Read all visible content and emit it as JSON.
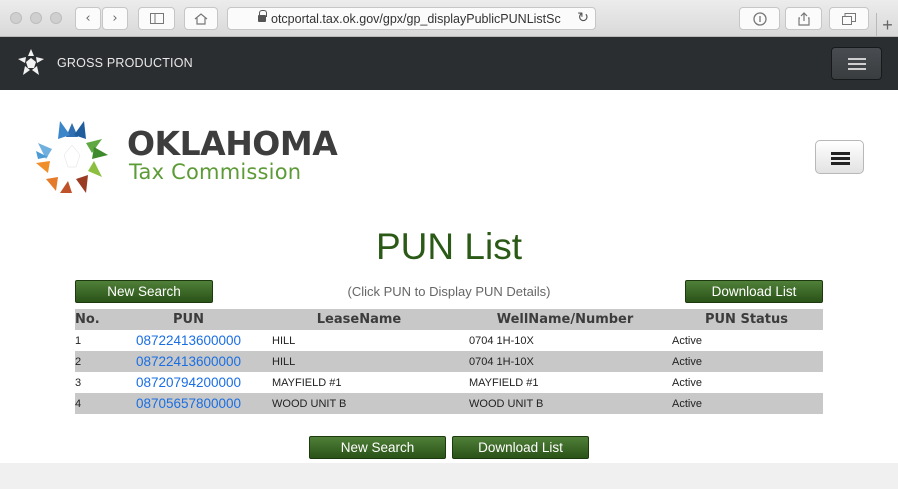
{
  "browser": {
    "url": "otcportal.tax.ok.gov/gpx/gp_displayPublicPUNListSc",
    "new_tab": "+"
  },
  "navbar": {
    "brand": "GROSS PRODUCTION"
  },
  "header": {
    "logo_title": "OKLAHOMA",
    "logo_subtitle": "Tax Commission"
  },
  "page": {
    "title": "PUN List",
    "hint": "(Click PUN to Display PUN Details)",
    "new_search_label": "New Search",
    "download_label": "Download List"
  },
  "table": {
    "headers": [
      "No.",
      "PUN",
      "LeaseName",
      "WellName/Number",
      "PUN Status"
    ],
    "rows": [
      {
        "no": "1",
        "pun": "08722413600000",
        "lease": "HILL",
        "well": "0704 1H-10X",
        "status": "Active"
      },
      {
        "no": "2",
        "pun": "08722413600000",
        "lease": "HILL",
        "well": "0704 1H-10X",
        "status": "Active"
      },
      {
        "no": "3",
        "pun": "08720794200000",
        "lease": "MAYFIELD #1",
        "well": "MAYFIELD #1",
        "status": "Active"
      },
      {
        "no": "4",
        "pun": "08705657800000",
        "lease": "WOOD UNIT B",
        "well": "WOOD UNIT B",
        "status": "Active"
      }
    ]
  },
  "colors": {
    "navbar_bg": "#2b2e31",
    "title_green": "#2b5a17",
    "button_green": "#3b6a26",
    "link_blue": "#1a6ee3",
    "row_stripe": "#c8c8c8"
  }
}
